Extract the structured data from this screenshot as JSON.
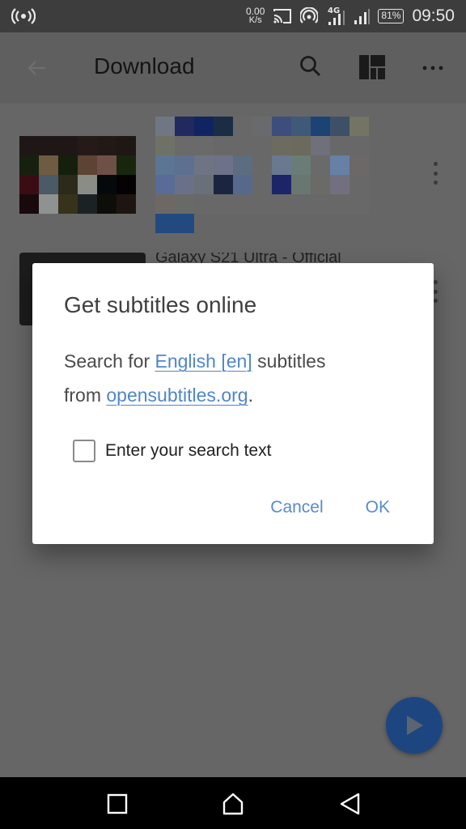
{
  "status_bar": {
    "net_speed_value": "0.00",
    "net_speed_unit": "K/s",
    "network_type": "4G",
    "battery": "81%",
    "time": "09:50",
    "icons": [
      "hotspot-icon",
      "cast-icon",
      "wifi-hotspot-icon",
      "signal-4g-icon",
      "signal-icon",
      "battery-icon"
    ]
  },
  "app_bar": {
    "title": "Download",
    "back_icon": "arrow-left-icon",
    "search_icon": "search-icon",
    "layout_icon": "layout-grid-icon",
    "more_icon": "more-horizontal-icon"
  },
  "list": {
    "items": [
      {
        "title": "",
        "blurred": true
      },
      {
        "title": "Galaxy S21 Ultra - Official",
        "blurred": true
      }
    ]
  },
  "dialog": {
    "title": "Get subtitles online",
    "body_prefix": "Search for ",
    "language_link": "English [en]",
    "body_middle": " subtitles",
    "body_from": "from ",
    "source_link": "opensubtitles.org",
    "body_suffix": ".",
    "checkbox_label": "Enter your search text",
    "checkbox_checked": false,
    "cancel_label": "Cancel",
    "ok_label": "OK"
  },
  "fab": {
    "icon": "play-icon"
  },
  "nav_bar": {
    "recents_icon": "recents-square-icon",
    "home_icon": "home-icon",
    "back_icon": "back-triangle-icon"
  },
  "colors": {
    "link": "#4f86cc",
    "button_text": "#5a8acb",
    "fab": "#1d4680",
    "scrim_bg": "#666666"
  }
}
